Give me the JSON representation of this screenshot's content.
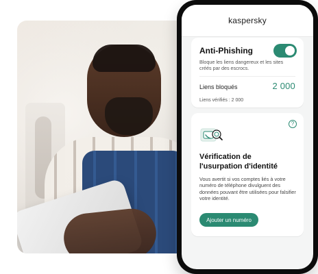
{
  "app": {
    "brand": "kaspersky"
  },
  "anti_phishing": {
    "title": "Anti-Phishing",
    "description": "Bloque les liens dangereux et les sites créés par des escrocs.",
    "blocked_label": "Liens bloqués",
    "blocked_value": "2 000",
    "verified_text": "Liens vérifiés : 2 000",
    "toggle_on": true
  },
  "identity": {
    "title": "Vérification de l'usurpation d'identité",
    "description": "Vous avertit si vos comptes liés à votre numéro de téléphone divulguent des données pouvant être utilisées pour falsifier votre identité.",
    "button": "Ajouter un numéro",
    "help_icon": "help-circle-icon",
    "illustration_icon": "phone-search-icon"
  },
  "colors": {
    "accent": "#2b8a72"
  }
}
